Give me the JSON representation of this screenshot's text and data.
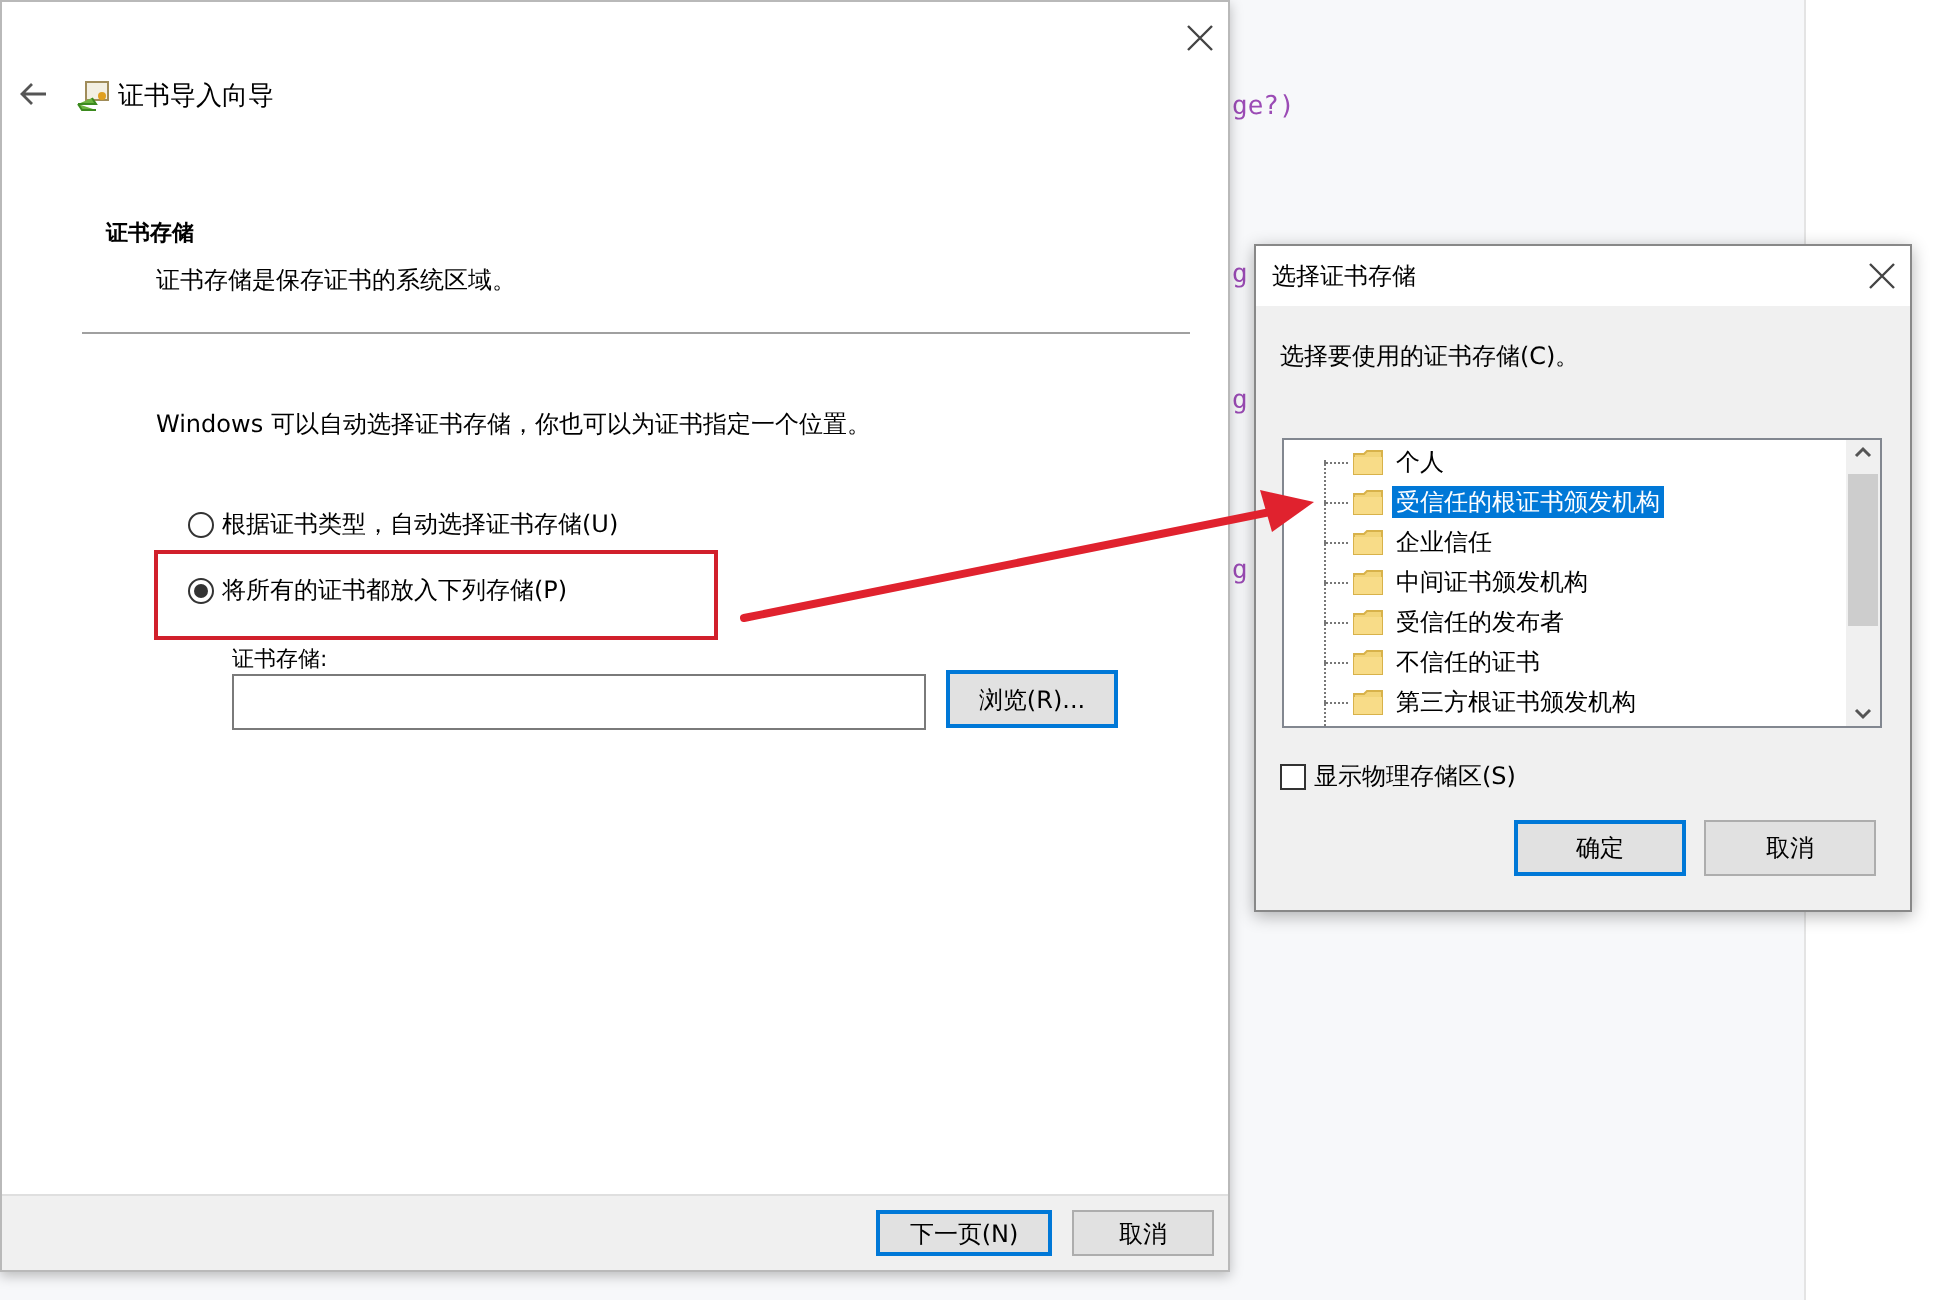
{
  "background_code": [
    "ge?)",
    "g",
    "g",
    "g"
  ],
  "wizard": {
    "title": "证书导入向导",
    "section_title": "证书存储",
    "section_description": "证书存储是保存证书的系统区域。",
    "intro": "Windows 可以自动选择证书存储，你也可以为证书指定一个位置。",
    "options": [
      {
        "label": "根据证书类型，自动选择证书存储(U)",
        "selected": false
      },
      {
        "label": "将所有的证书都放入下列存储(P)",
        "selected": true
      }
    ],
    "store_label": "证书存储:",
    "browse_button": "浏览(R)...",
    "buttons": [
      {
        "label": "下一页(N)",
        "default": true
      },
      {
        "label": "取消",
        "default": false
      }
    ]
  },
  "dialog": {
    "title": "选择证书存储",
    "prompt": "选择要使用的证书存储(C)。",
    "stores": [
      {
        "label": "个人",
        "selected": false
      },
      {
        "label": "受信任的根证书颁发机构",
        "selected": true
      },
      {
        "label": "企业信任",
        "selected": false
      },
      {
        "label": "中间证书颁发机构",
        "selected": false
      },
      {
        "label": "受信任的发布者",
        "selected": false
      },
      {
        "label": "不信任的证书",
        "selected": false
      },
      {
        "label": "第三方根证书颁发机构",
        "selected": false
      }
    ],
    "show_physical": {
      "label": "显示物理存储区(S)",
      "checked": false
    },
    "buttons": [
      {
        "label": "确定",
        "default": true
      },
      {
        "label": "取消",
        "default": false
      }
    ]
  }
}
